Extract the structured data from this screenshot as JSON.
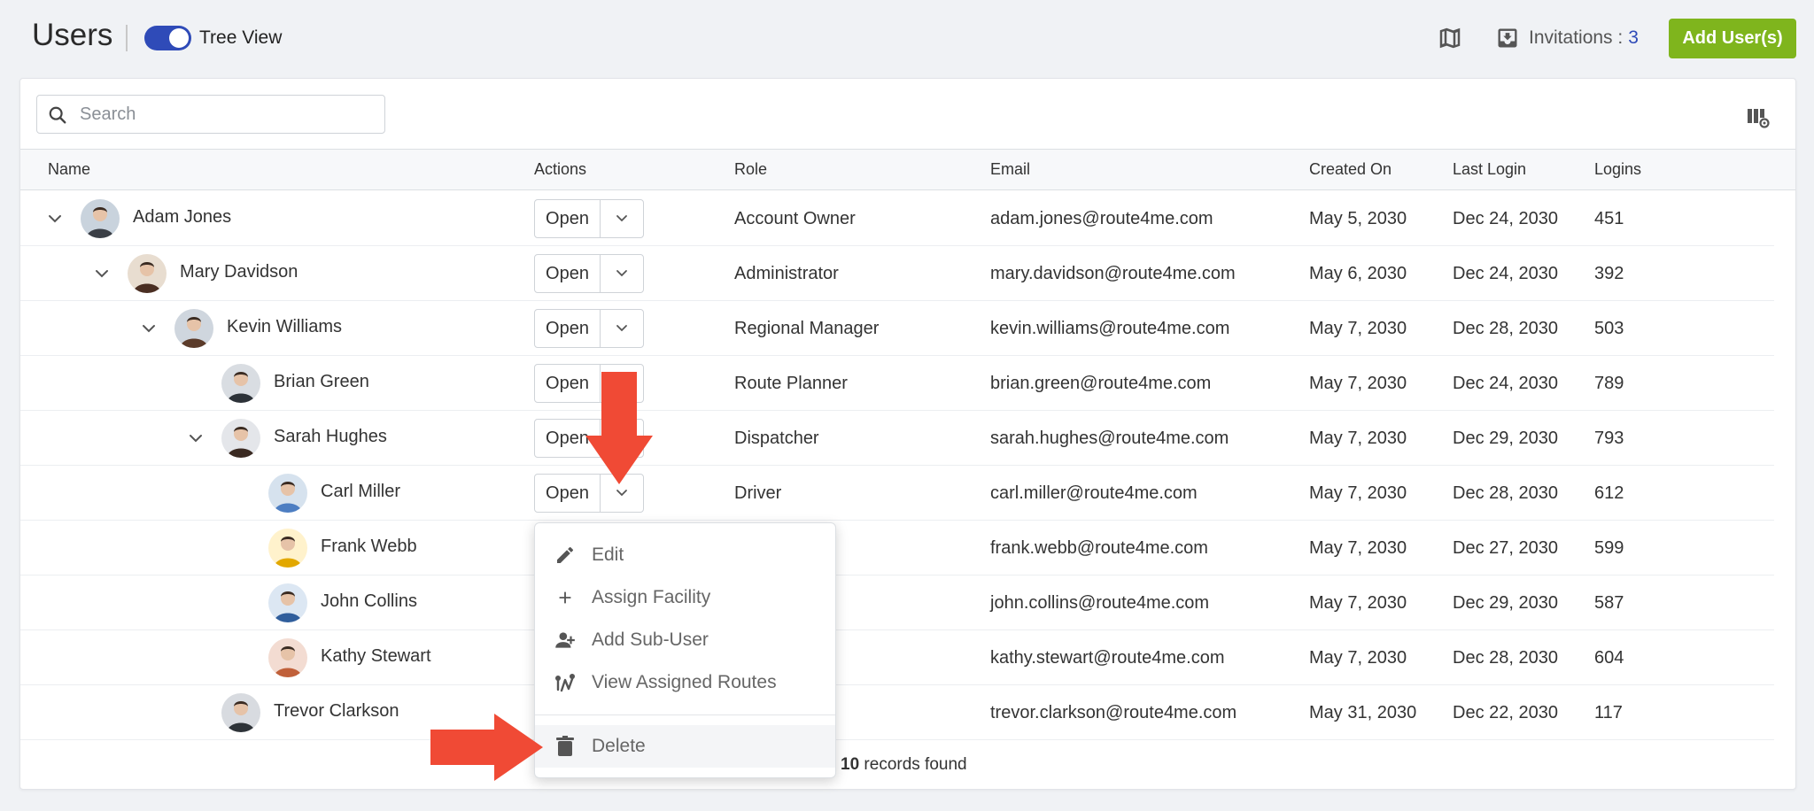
{
  "header": {
    "title": "Users",
    "tree_view_label": "Tree View",
    "invitations_label": "Invitations :",
    "invitations_count": "3",
    "add_button": "Add User(s)"
  },
  "search": {
    "placeholder": "Search"
  },
  "table": {
    "columns": [
      "Name",
      "Actions",
      "Role",
      "Email",
      "Created On",
      "Last Login",
      "Logins"
    ],
    "open_label": "Open",
    "rows": [
      {
        "name": "Adam Jones",
        "role": "Account Owner",
        "email": "adam.jones@route4me.com",
        "created": "May 5, 2030",
        "last_login": "Dec 24, 2030",
        "logins": "451"
      },
      {
        "name": "Mary Davidson",
        "role": "Administrator",
        "email": "mary.davidson@route4me.com",
        "created": "May 6, 2030",
        "last_login": "Dec 24, 2030",
        "logins": "392"
      },
      {
        "name": "Kevin Williams",
        "role": "Regional Manager",
        "email": "kevin.williams@route4me.com",
        "created": "May 7, 2030",
        "last_login": "Dec 28, 2030",
        "logins": "503"
      },
      {
        "name": "Brian Green",
        "role": "Route Planner",
        "email": "brian.green@route4me.com",
        "created": "May 7, 2030",
        "last_login": "Dec 24, 2030",
        "logins": "789"
      },
      {
        "name": "Sarah Hughes",
        "role": "Dispatcher",
        "email": "sarah.hughes@route4me.com",
        "created": "May 7, 2030",
        "last_login": "Dec 29, 2030",
        "logins": "793"
      },
      {
        "name": "Carl Miller",
        "role": "Driver",
        "email": "carl.miller@route4me.com",
        "created": "May 7, 2030",
        "last_login": "Dec 28, 2030",
        "logins": "612"
      },
      {
        "name": "Frank Webb",
        "role": "",
        "email": "frank.webb@route4me.com",
        "created": "May 7, 2030",
        "last_login": "Dec 27, 2030",
        "logins": "599"
      },
      {
        "name": "John Collins",
        "role": "",
        "email": "john.collins@route4me.com",
        "created": "May 7, 2030",
        "last_login": "Dec 29, 2030",
        "logins": "587"
      },
      {
        "name": "Kathy Stewart",
        "role": "",
        "email": "kathy.stewart@route4me.com",
        "created": "May 7, 2030",
        "last_login": "Dec 28, 2030",
        "logins": "604"
      },
      {
        "name": "Trevor Clarkson",
        "role": "",
        "email": "trevor.clarkson@route4me.com",
        "created": "May 31, 2030",
        "last_login": "Dec 22, 2030",
        "logins": "117"
      }
    ]
  },
  "footer": {
    "count": "10",
    "label": "records found"
  },
  "menu": {
    "items": [
      "Edit",
      "Assign Facility",
      "Add Sub-User",
      "View Assigned Routes"
    ],
    "delete": "Delete"
  },
  "colors": {
    "accent": "#2f4bb8",
    "add_button": "#7fb51d",
    "arrow": "#f04a35"
  }
}
